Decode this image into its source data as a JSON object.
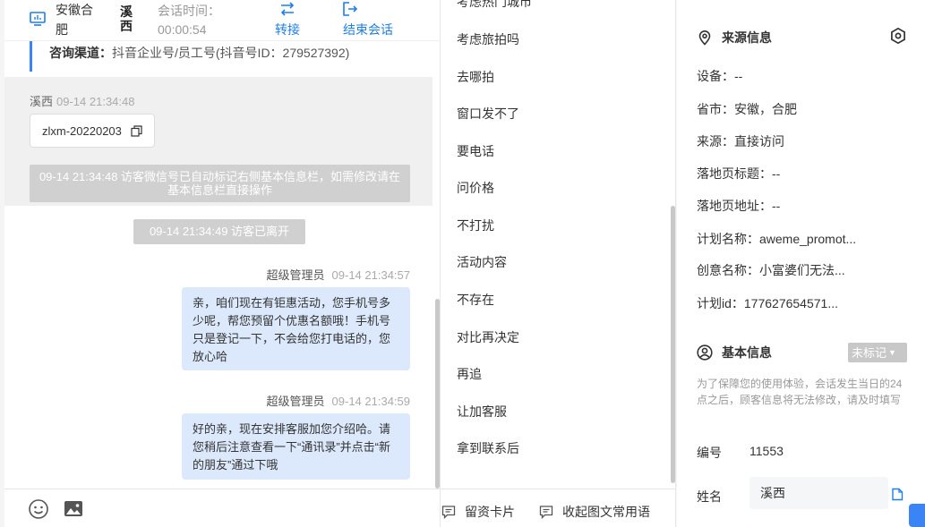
{
  "header": {
    "location": "安徽合肥",
    "visitor_name": "溪西",
    "session_time_label": "会话时间：",
    "session_time": "00:00:54",
    "transfer_label": "转接",
    "end_label": "结束会话"
  },
  "chat": {
    "channel_label": "咨询渠道：",
    "channel_value": "抖音企业号/员工号(抖音号ID：279527392)",
    "visitor_sender": "溪西",
    "visitor_time": "09-14 21:34:48",
    "file_name": "zlxm-20220203",
    "system_msg_1": "09-14 21:34:48 访客微信号已自动标记右侧基本信息栏，如需修改请在基本信息栏直接操作",
    "system_msg_2": "09-14 21:34:49 访客已离开",
    "messages": [
      {
        "sender": "超级管理员",
        "time": "09-14 21:34:57",
        "text": "亲，咱们现在有钜惠活动，您手机号多少呢，帮您预留个优惠名额哦！手机号只是登记一下，不会给您打电话的，您放心哈"
      },
      {
        "sender": "超级管理员",
        "time": "09-14 21:34:59",
        "text": "好的亲，现在安排客服加您介绍哈。请您稍后注意查看一下“通讯录”并点击“新的朋友”通过下哦"
      }
    ]
  },
  "quick_replies": [
    "考虑热门城市",
    "考虑旅拍吗",
    "去哪拍",
    "窗口发不了",
    "要电话",
    "问价格",
    "不打扰",
    "活动内容",
    "不存在",
    "对比再决定",
    "再追",
    "让加客服",
    "拿到联系后"
  ],
  "quick_footer": {
    "card_label": "留资卡片",
    "collapse_label": "收起图文常用语"
  },
  "source_info": {
    "title": "来源信息",
    "lines": [
      "设备：--",
      "省市：安徽，合肥",
      "来源：直接访问",
      "落地页标题：--",
      "落地页地址：--",
      "计划名称：aweme_promot...",
      "创意名称：小富婆们无法...",
      "计划id：177627654571..."
    ]
  },
  "basic_info": {
    "title": "基本信息",
    "tag_label": "未标记",
    "notice": "为了保障您的使用体验，会话发生当日的24点之后，顾客信息将无法修改，请及时填写",
    "id_label": "编号",
    "id_value": "11553",
    "name_label": "姓名",
    "name_value": "溪西"
  },
  "colors": {
    "accent": "#1e7fe6",
    "bubble": "#dce8fb",
    "system": "#d0d0d0"
  }
}
